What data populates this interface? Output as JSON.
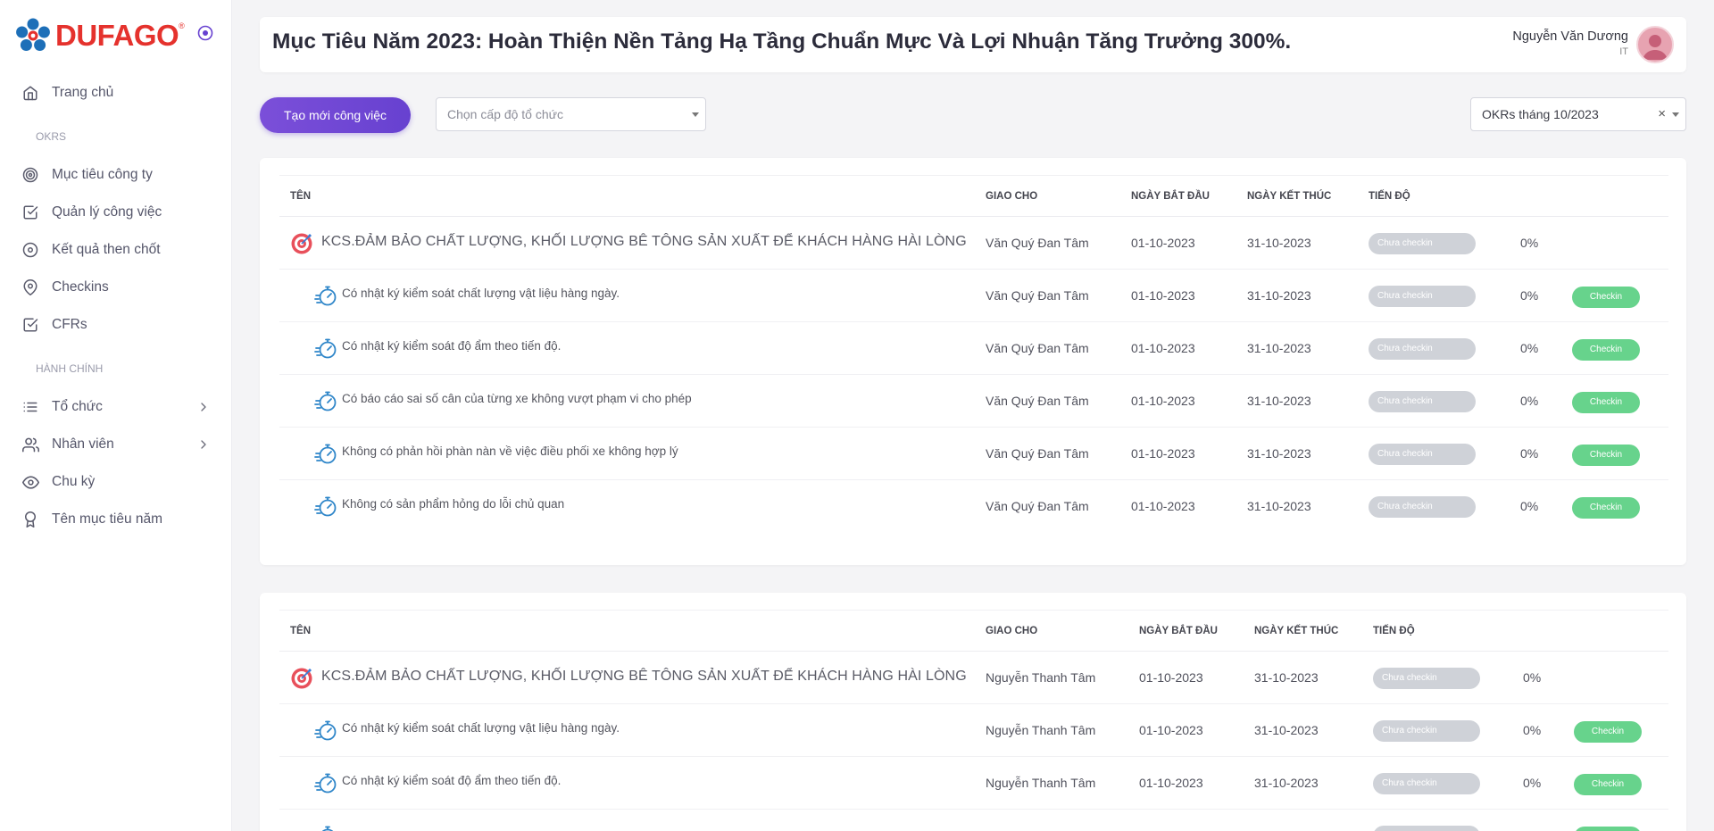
{
  "brand": {
    "name": "DUFAGO",
    "reg_mark": "®"
  },
  "sidebar": {
    "items": [
      {
        "label": "Trang chủ",
        "icon": "home-icon"
      },
      {
        "section": "OKRS"
      },
      {
        "label": "Mục tiêu công ty",
        "icon": "target-icon"
      },
      {
        "label": "Quản lý công việc",
        "icon": "checkbox-icon"
      },
      {
        "label": "Kết quả then chốt",
        "icon": "circle-dot-icon"
      },
      {
        "label": "Checkins",
        "icon": "map-pin-icon"
      },
      {
        "label": "CFRs",
        "icon": "checkbox-icon"
      },
      {
        "section": "HÀNH CHÍNH"
      },
      {
        "label": "Tổ chức",
        "icon": "list-icon",
        "has_submenu": true
      },
      {
        "label": "Nhân viên",
        "icon": "users-icon",
        "has_submenu": true
      },
      {
        "label": "Chu kỳ",
        "icon": "eye-icon"
      },
      {
        "label": "Tên mục tiêu năm",
        "icon": "award-icon"
      }
    ]
  },
  "header": {
    "title": "Mục Tiêu Năm 2023: Hoàn Thiện Nền Tảng Hạ Tầng Chuẩn Mực Và Lợi Nhuận Tăng Trưởng 300%.",
    "user_name": "Nguyễn Văn Dương",
    "user_dept": "IT"
  },
  "toolbar": {
    "create_label": "Tạo mới công việc",
    "org_placeholder": "Chọn cấp độ tổ chức",
    "period_value": "OKRs tháng 10/2023",
    "clear_label": "×"
  },
  "columns": {
    "name": "TÊN",
    "assignee": "GIAO CHO",
    "start": "NGÀY BẮT ĐẦU",
    "end": "NGÀY KẾT THÚC",
    "progress": "TIẾN ĐỘ"
  },
  "okr_groups": [
    {
      "objective": {
        "name": "KCS.ĐẢM BẢO CHẤT LƯỢNG, KHỐI LƯỢNG BÊ TÔNG SẢN XUẤT ĐỂ KHÁCH HÀNG HÀI LÒNG",
        "assignee": "Văn Quý Đan Tâm",
        "start": "01-10-2023",
        "end": "31-10-2023",
        "status": "Chưa checkin",
        "percent": "0%"
      },
      "key_results": [
        {
          "name": "Có nhật ký kiểm soát chất lượng vật liệu hàng ngày.",
          "assignee": "Văn Quý Đan Tâm",
          "start": "01-10-2023",
          "end": "31-10-2023",
          "status": "Chưa checkin",
          "percent": "0%",
          "action": "Checkin"
        },
        {
          "name": "Có nhật ký kiểm soát độ ẩm theo tiến độ.",
          "assignee": "Văn Quý Đan Tâm",
          "start": "01-10-2023",
          "end": "31-10-2023",
          "status": "Chưa checkin",
          "percent": "0%",
          "action": "Checkin"
        },
        {
          "name": "Có báo cáo sai số cân của từng xe không vượt phạm vi cho phép",
          "assignee": "Văn Quý Đan Tâm",
          "start": "01-10-2023",
          "end": "31-10-2023",
          "status": "Chưa checkin",
          "percent": "0%",
          "action": "Checkin"
        },
        {
          "name": "Không có phản hồi phàn nàn về việc điều phối xe không hợp lý",
          "assignee": "Văn Quý Đan Tâm",
          "start": "01-10-2023",
          "end": "31-10-2023",
          "status": "Chưa checkin",
          "percent": "0%",
          "action": "Checkin"
        },
        {
          "name": "Không có sản phẩm hỏng do lỗi chủ quan",
          "assignee": "Văn Quý Đan Tâm",
          "start": "01-10-2023",
          "end": "31-10-2023",
          "status": "Chưa checkin",
          "percent": "0%",
          "action": "Checkin"
        }
      ]
    },
    {
      "objective": {
        "name": "KCS.ĐẢM BẢO CHẤT LƯỢNG, KHỐI LƯỢNG BÊ TÔNG SẢN XUẤT ĐỂ KHÁCH HÀNG HÀI LÒNG",
        "assignee": "Nguyễn Thanh Tâm",
        "start": "01-10-2023",
        "end": "31-10-2023",
        "status": "Chưa checkin",
        "percent": "0%"
      },
      "key_results": [
        {
          "name": "Có nhật ký kiểm soát chất lượng vật liệu hàng ngày.",
          "assignee": "Nguyễn Thanh Tâm",
          "start": "01-10-2023",
          "end": "31-10-2023",
          "status": "Chưa checkin",
          "percent": "0%",
          "action": "Checkin"
        },
        {
          "name": "Có nhật ký kiểm soát độ ẩm theo tiến độ.",
          "assignee": "Nguyễn Thanh Tâm",
          "start": "01-10-2023",
          "end": "31-10-2023",
          "status": "Chưa checkin",
          "percent": "0%",
          "action": "Checkin"
        },
        {
          "name": "",
          "assignee": "",
          "start": "",
          "end": "",
          "status": "",
          "percent": "",
          "action": ""
        }
      ]
    }
  ],
  "colors": {
    "brand_red": "#e5322d",
    "brand_blue": "#1d6fb8",
    "accent_purple": "#6741d0",
    "checkin_green": "#67d38c",
    "status_gray": "#cfd2d8"
  }
}
